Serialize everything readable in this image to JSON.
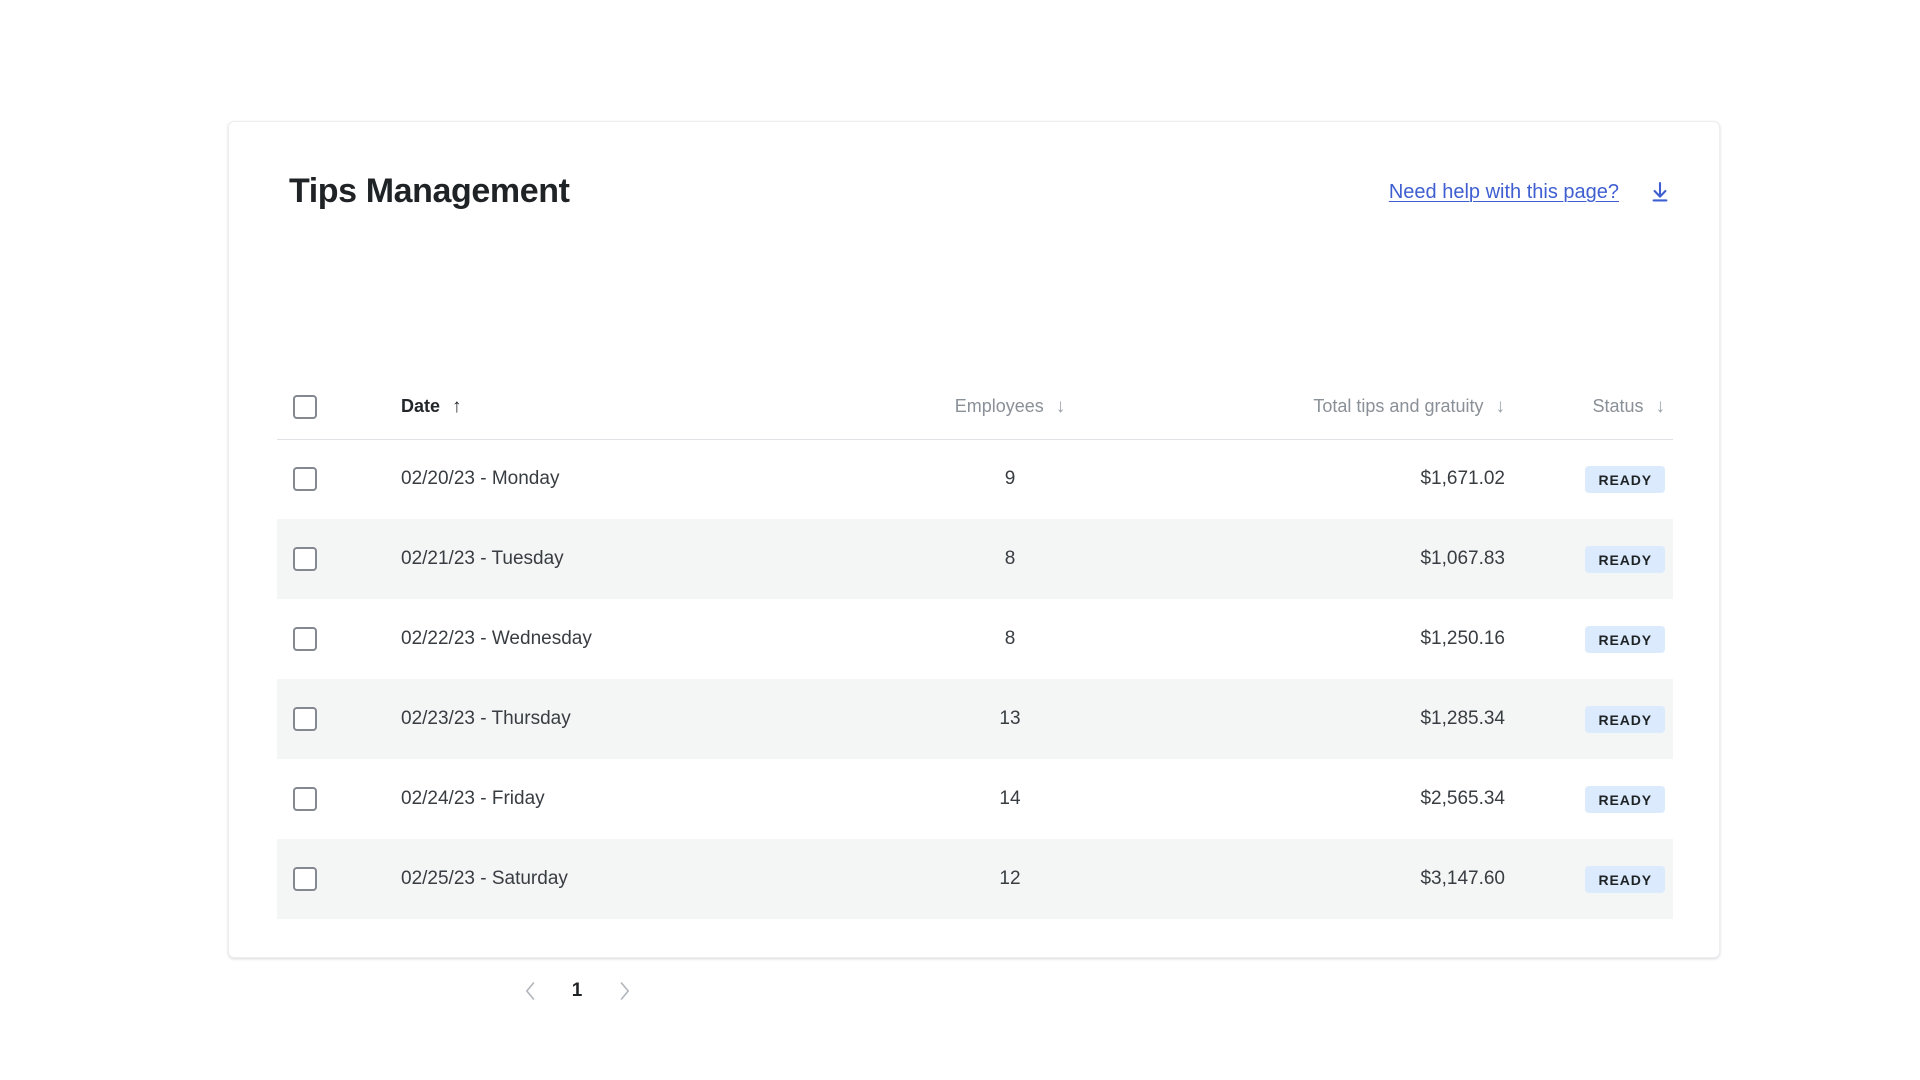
{
  "header": {
    "title": "Tips Management",
    "help_link_label": "Need help with this page?",
    "download_icon_name": "download-icon",
    "link_color": "#3f5fd1"
  },
  "table": {
    "select_all_checkbox": "",
    "columns": [
      {
        "key": "select",
        "label": "",
        "align": "left",
        "sorted": false,
        "sort_dir": ""
      },
      {
        "key": "date",
        "label": "Date",
        "align": "left",
        "sorted": true,
        "sort_dir": "up"
      },
      {
        "key": "employees",
        "label": "Employees",
        "align": "center",
        "sorted": false,
        "sort_dir": "down"
      },
      {
        "key": "total",
        "label": "Total tips and gratuity",
        "align": "right",
        "sorted": false,
        "sort_dir": "down"
      },
      {
        "key": "status",
        "label": "Status",
        "align": "right",
        "sorted": false,
        "sort_dir": "down"
      }
    ],
    "rows": [
      {
        "date": "02/20/23 - Monday",
        "employees": "9",
        "total": "$1,671.02",
        "status": "READY"
      },
      {
        "date": "02/21/23 - Tuesday",
        "employees": "8",
        "total": "$1,067.83",
        "status": "READY"
      },
      {
        "date": "02/22/23 - Wednesday",
        "employees": "8",
        "total": "$1,250.16",
        "status": "READY"
      },
      {
        "date": "02/23/23 - Thursday",
        "employees": "13",
        "total": "$1,285.34",
        "status": "READY"
      },
      {
        "date": "02/24/23 - Friday",
        "employees": "14",
        "total": "$2,565.34",
        "status": "READY"
      },
      {
        "date": "02/25/23 - Saturday",
        "employees": "12",
        "total": "$3,147.60",
        "status": "READY"
      }
    ]
  },
  "pagination": {
    "prev_label": "‹",
    "current_page": "1",
    "next_label": "›"
  },
  "colors": {
    "badge_bg": "#dbeafc",
    "stripe_bg": "#f4f5f5",
    "header_text": "#8a9097",
    "body_text": "#383d42"
  }
}
